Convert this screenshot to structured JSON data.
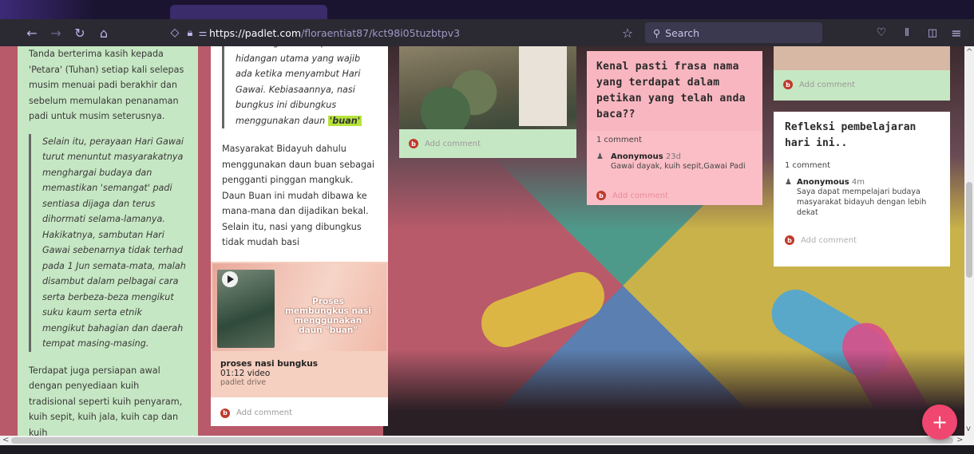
{
  "browser": {
    "url_host": "https://padlet.com",
    "url_path": "/floraentiat87/kct98i05tuzbtpv3",
    "search_placeholder": "Search",
    "icons": [
      "back-arrow-icon",
      "forward-arrow-icon",
      "reload-icon",
      "home-icon",
      "shield-icon",
      "lock-icon",
      "permissions-icon",
      "bookmark-star-icon",
      "search-icon",
      "pocket-icon",
      "library-icon",
      "sidebar-icon",
      "menu-icon"
    ]
  },
  "col1": {
    "text_top": "Tanda berterima kasih kepada 'Petara' (Tuhan) setiap kali selepas musim menuai padi berakhir dan sebelum memulakan penanaman padi untuk musim seterusnya.",
    "quote": "Selain itu, perayaan Hari Gawai turut menuntut masyarakatnya menghargai budaya dan memastikan 'semangat' padi sentiasa dijaga dan terus dihormati selama-lamanya. Hakikatnya, sambutan Hari Gawai sebenarnya tidak terhad pada 1 Jun semata-mata, malah disambut dalam pelbagai cara serta berbeza-beza mengikut suku kaum serta etnik mengikut bahagian dan daerah tempat masing-masing.",
    "text_bottom": "Terdapat juga persiapan awal dengan penyediaan kuih tradisional seperti kuih penyaram, kuih sepit, kuih jala, kuih cap dan kuih"
  },
  "col2": {
    "quote_pre": "nasi bungkus merupakan hidangan utama yang wajib ada ketika menyambut Hari Gawai. Kebiasaannya, nasi bungkus ini dibungkus menggunakan daun ",
    "quote_highlight": "'buan'",
    "paragraph": "Masyarakat Bidayuh dahulu menggunakan daun buan sebagai pengganti pinggan mangkuk. Daun Buan ini mudah dibawa ke mana-mana dan dijadikan bekal. Selain itu, nasi yang dibungkus tidak mudah basi",
    "video": {
      "thumb_title": "Proses membungkus nasi menggunakan daun \"buan\"",
      "name": "proses nasi bungkus",
      "duration": "01:12 video",
      "source": "padlet drive"
    },
    "add_comment": "Add comment"
  },
  "col3": {
    "add_comment": "Add comment"
  },
  "col4": {
    "title": "Kenal pasti frasa nama yang terdapat dalam petikan yang telah anda baca??",
    "comment_count": "1 comment",
    "comment_author": "Anonymous",
    "comment_time": "23d",
    "comment_text": "Gawai dayak, kuih sepit,Gawai Padi",
    "add_comment": "Add comment"
  },
  "col5": {
    "top_add_comment": "Add comment",
    "title": "Refleksi pembelajaran hari ini..",
    "comment_count": "1 comment",
    "comment_author": "Anonymous",
    "comment_time": "4m",
    "comment_text": "Saya dapat mempelajari budaya masyarakat bidayuh dengan lebih dekat",
    "add_comment": "Add comment"
  },
  "avatar_letter": "b",
  "fab_label": "+",
  "colors": {
    "accent": "#ef476f",
    "green_card": "#c6e7c3",
    "pink_card": "#f8b6c0"
  }
}
